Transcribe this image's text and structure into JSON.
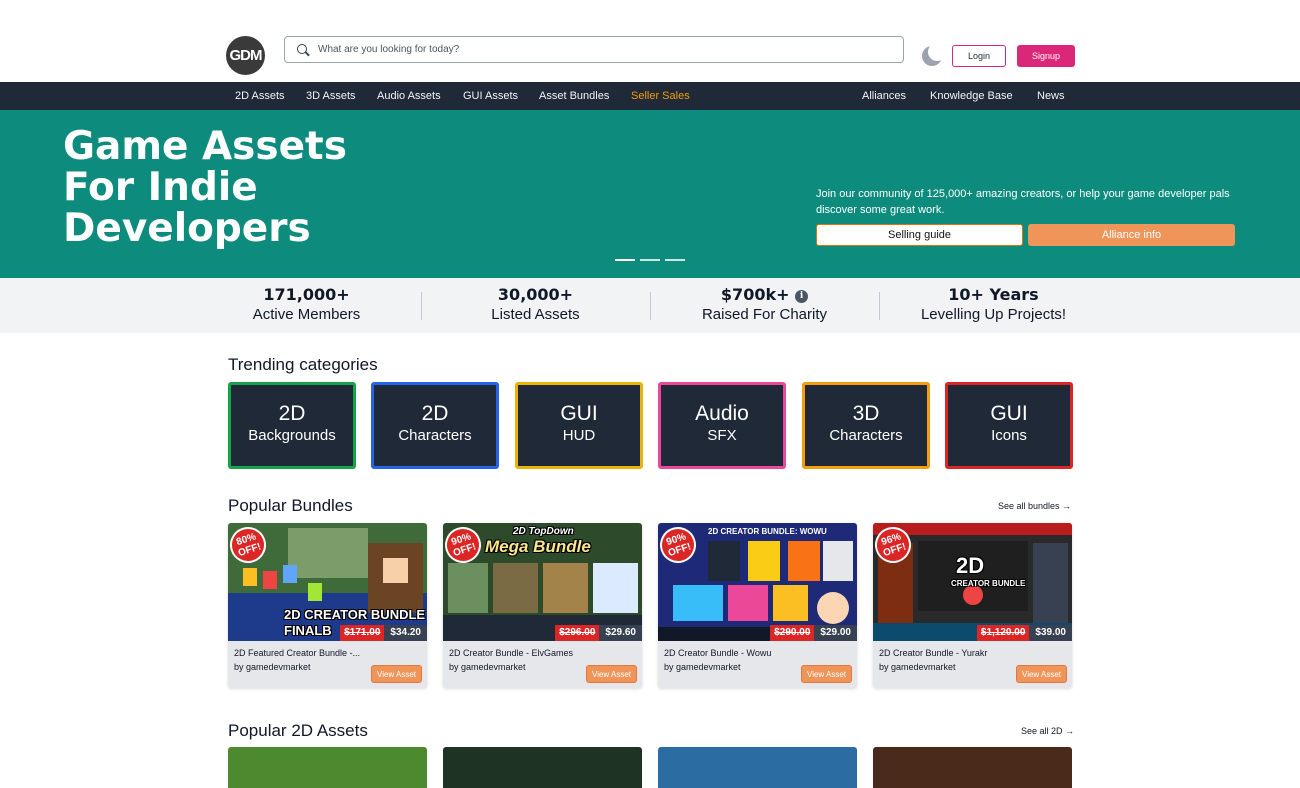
{
  "header": {
    "logo_text": "GDM",
    "search_placeholder": "What are you looking for today?",
    "login_label": "Login",
    "signup_label": "Signup"
  },
  "nav": {
    "left": [
      "2D Assets",
      "3D Assets",
      "Audio Assets",
      "GUI Assets",
      "Asset Bundles",
      "Seller Sales"
    ],
    "right": [
      "Alliances",
      "Knowledge Base",
      "News"
    ]
  },
  "hero": {
    "title_lines": [
      "Game Assets",
      "For Indie",
      "Developers"
    ],
    "text": "Join our community of 125,000+ amazing creators, or help your game developer pals discover some great work.",
    "selling_label": "Selling guide",
    "alliance_label": "Alliance info"
  },
  "stats": [
    {
      "value": "171,000+",
      "label": "Active Members"
    },
    {
      "value": "30,000+",
      "label": "Listed Assets"
    },
    {
      "value": "$700k+",
      "label": "Raised For Charity"
    },
    {
      "value": "10+ Years",
      "label": "Levelling Up Projects!"
    }
  ],
  "trending": {
    "title": "Trending categories",
    "items": [
      {
        "main": "2D",
        "sub": "Backgrounds",
        "color": "#16a34a"
      },
      {
        "main": "2D",
        "sub": "Characters",
        "color": "#2563eb"
      },
      {
        "main": "GUI",
        "sub": "HUD",
        "color": "#eab308"
      },
      {
        "main": "Audio",
        "sub": "SFX",
        "color": "#ec4899"
      },
      {
        "main": "3D",
        "sub": "Characters",
        "color": "#f59e0b"
      },
      {
        "main": "GUI",
        "sub": "Icons",
        "color": "#dc2626"
      }
    ]
  },
  "bundles": {
    "title": "Popular Bundles",
    "see_all": "See all bundles →",
    "view_label": "View Asset",
    "items": [
      {
        "title": "2D Featured Creator Bundle -...",
        "author": "by gamedevmarket",
        "old_price": "$171.00",
        "new_price": "$34.20",
        "badge_pct": "80%",
        "badge_off": "OFF!",
        "caption1": "2D CREATOR BUNDLE",
        "caption2": "FINALB"
      },
      {
        "title": "2D Creator Bundle - ElvGames",
        "author": "by gamedevmarket",
        "old_price": "$296.00",
        "new_price": "$29.60",
        "badge_pct": "90%",
        "badge_off": "OFF!",
        "caption1": "2D TopDown",
        "caption2": "Mega Bundle"
      },
      {
        "title": "2D Creator Bundle - Wowu",
        "author": "by gamedevmarket",
        "old_price": "$290.00",
        "new_price": "$29.00",
        "badge_pct": "90%",
        "badge_off": "OFF!",
        "caption1": "2D CREATOR BUNDLE: WOWU",
        "caption2": ""
      },
      {
        "title": "2D Creator Bundle - Yurakr",
        "author": "by gamedevmarket",
        "old_price": "$1,120.00",
        "new_price": "$39.00",
        "badge_pct": "96%",
        "badge_off": "OFF!",
        "caption1": "2D",
        "caption2": "CREATOR BUNDLE"
      }
    ]
  },
  "popular2d": {
    "title": "Popular 2D Assets",
    "see_all": "See all 2D →"
  }
}
